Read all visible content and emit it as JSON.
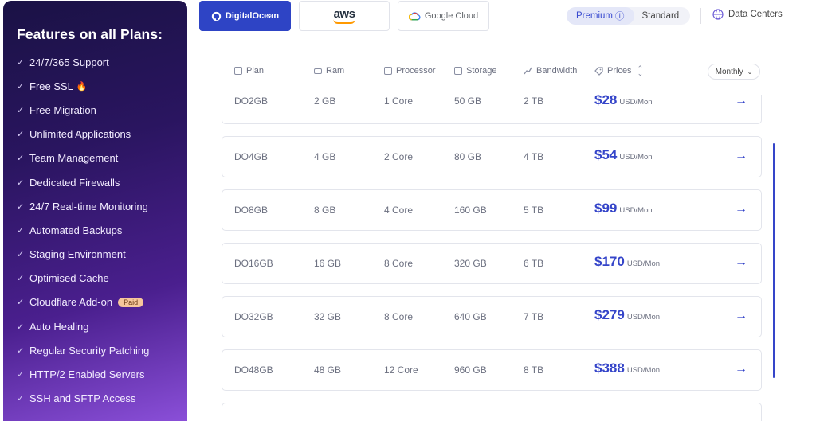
{
  "features": {
    "title": "Features on all Plans:",
    "items": [
      "24/7/365 Support",
      "Free SSL",
      "Free Migration",
      "Unlimited Applications",
      "Team Management",
      "Dedicated Firewalls",
      "24/7 Real-time Monitoring",
      "Automated Backups",
      "Staging Environment",
      "Optimised Cache",
      "Cloudflare Add-on",
      "Auto Healing",
      "Regular Security Patching",
      "HTTP/2 Enabled Servers",
      "SSH and SFTP Access"
    ],
    "paid_badge": "Paid",
    "check_glyph": "✓",
    "fire_glyph": "🔥"
  },
  "providers": {
    "digitalocean": "DigitalOcean",
    "aws": "aws",
    "googlecloud": "Google Cloud"
  },
  "plan_type": {
    "premium": "Premium",
    "standard": "Standard",
    "info_glyph": "ⓘ"
  },
  "data_centers": "Data Centers",
  "table": {
    "headers": {
      "plan": "Plan",
      "ram": "Ram",
      "processor": "Processor",
      "storage": "Storage",
      "bandwidth": "Bandwidth",
      "prices": "Prices"
    },
    "period": "Monthly",
    "rows": [
      {
        "plan": "DO2GB",
        "ram": "2 GB",
        "processor": "1 Core",
        "storage": "50 GB",
        "bandwidth": "2 TB",
        "price": "$28",
        "unit": "USD/Mon"
      },
      {
        "plan": "DO4GB",
        "ram": "4 GB",
        "processor": "2 Core",
        "storage": "80 GB",
        "bandwidth": "4 TB",
        "price": "$54",
        "unit": "USD/Mon"
      },
      {
        "plan": "DO8GB",
        "ram": "8 GB",
        "processor": "4 Core",
        "storage": "160 GB",
        "bandwidth": "5 TB",
        "price": "$99",
        "unit": "USD/Mon"
      },
      {
        "plan": "DO16GB",
        "ram": "16 GB",
        "processor": "8 Core",
        "storage": "320 GB",
        "bandwidth": "6 TB",
        "price": "$170",
        "unit": "USD/Mon"
      },
      {
        "plan": "DO32GB",
        "ram": "32 GB",
        "processor": "8 Core",
        "storage": "640 GB",
        "bandwidth": "7 TB",
        "price": "$279",
        "unit": "USD/Mon"
      },
      {
        "plan": "DO48GB",
        "ram": "48 GB",
        "processor": "12 Core",
        "storage": "960 GB",
        "bandwidth": "8 TB",
        "price": "$388",
        "unit": "USD/Mon"
      }
    ],
    "arrow_glyph": "→"
  },
  "colors": {
    "accent": "#3545c9",
    "panel_dark": "#1a1245",
    "panel_light": "#8a4fd8"
  }
}
